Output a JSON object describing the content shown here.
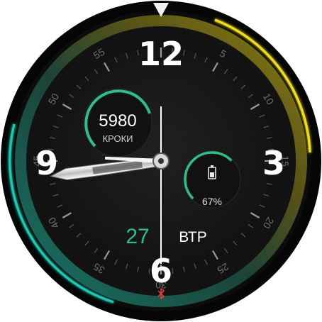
{
  "watch_face": {
    "hour_markers": [
      "12",
      "3",
      "6",
      "9"
    ],
    "minute_markers": [
      "5",
      "10",
      "15",
      "20",
      "25",
      "30",
      "35",
      "40",
      "45",
      "50",
      "55"
    ],
    "steps": {
      "value": "5980",
      "label": "КРОКИ"
    },
    "battery": {
      "percent_text": "67%",
      "level": 0.67
    },
    "date": {
      "day": "27",
      "weekday": "ВТР"
    },
    "time": {
      "hour": 8,
      "minute": 45,
      "second": 30
    },
    "colors": {
      "accent_green": "#2fbf86",
      "ring_gradient_start": "#1ec7b0",
      "ring_gradient_end": "#e6d421",
      "bluetooth_red": "#e23b3b",
      "dial_bg": "#151515"
    },
    "icons": {
      "top_indicator": "triangle-pointer-icon",
      "battery": "battery-icon",
      "bluetooth": "bluetooth-icon"
    }
  }
}
